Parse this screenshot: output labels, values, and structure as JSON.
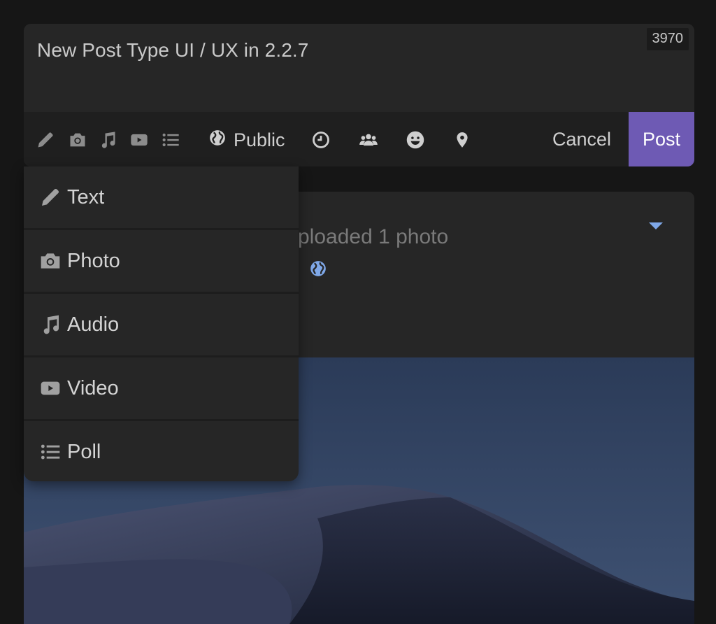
{
  "composer": {
    "text": "New Post Type UI / UX in 2.2.7",
    "char_count": "3970",
    "toolbar": {
      "icons": [
        "pencil-icon",
        "camera-icon",
        "music-icon",
        "video-icon",
        "list-icon"
      ],
      "visibility_label": "Public",
      "extra_icons": [
        "clock-icon",
        "users-icon",
        "smiley-icon",
        "location-pin-icon"
      ],
      "cancel_label": "Cancel",
      "post_label": "Post"
    },
    "accent_color": "#6e5ab4"
  },
  "post_type_menu": {
    "items": [
      {
        "label": "Text",
        "icon": "pencil-icon"
      },
      {
        "label": "Photo",
        "icon": "camera-icon"
      },
      {
        "label": "Audio",
        "icon": "music-icon"
      },
      {
        "label": "Video",
        "icon": "video-icon"
      },
      {
        "label": "Poll",
        "icon": "list-icon"
      }
    ]
  },
  "feed": {
    "subtitle_visible": "ploaded 1 photo",
    "visibility_icon": "globe-icon",
    "link_color": "#7fa8e8"
  }
}
